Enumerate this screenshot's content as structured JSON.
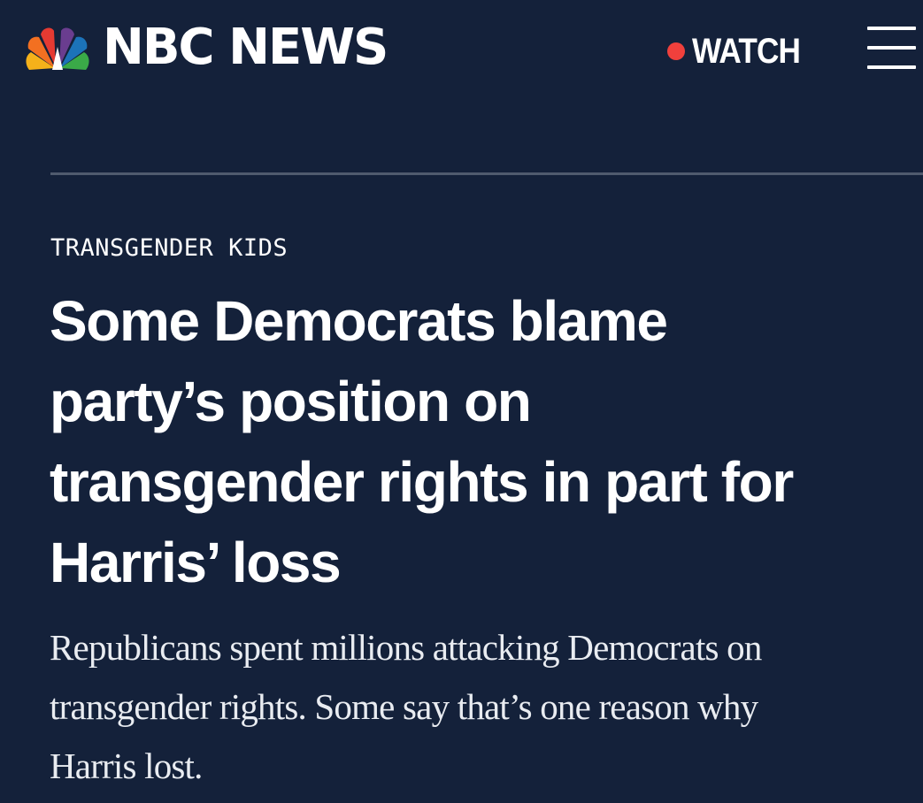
{
  "header": {
    "logo_text": "NBC NEWS",
    "logo_icon": "nbc-peacock-icon",
    "watch_label": "WATCH",
    "live_dot_color": "#f0403c",
    "menu_icon": "hamburger-menu-icon"
  },
  "article": {
    "category": "TRANSGENDER KIDS",
    "headline_lines": [
      "Some Democrats blame",
      "party’s position on",
      "transgender rights in part for",
      "Harris’ loss"
    ],
    "dek_lines": [
      "Republicans spent millions attacking Democrats on",
      "transgender rights. Some say that’s one reason why",
      "Harris lost."
    ]
  },
  "colors": {
    "background": "#14213a",
    "text": "#ffffff",
    "divider": "#505b6e",
    "peacock": [
      "#f5b11a",
      "#f37021",
      "#e53a32",
      "#6a3d8f",
      "#1c73b9",
      "#3aaa48"
    ]
  }
}
